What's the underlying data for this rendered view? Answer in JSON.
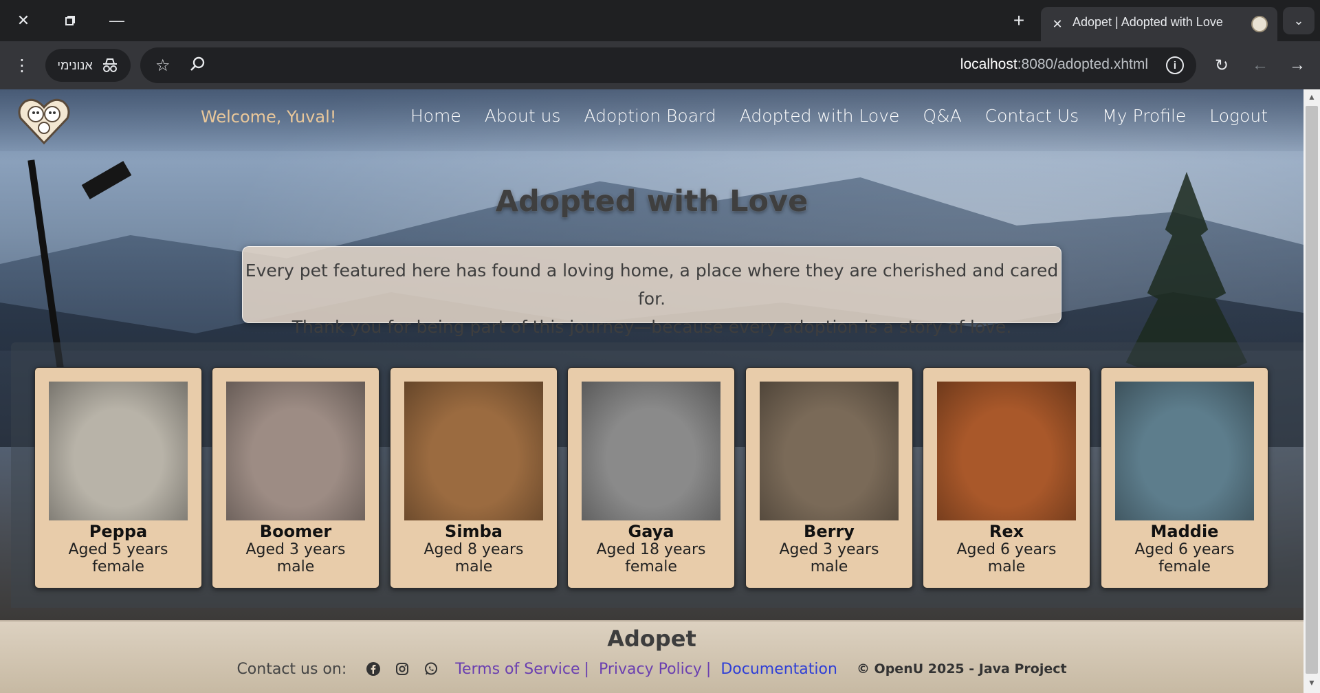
{
  "browser": {
    "tab_title": "Adopet | Adopted with Love",
    "incognito_label": "אנונימי",
    "url_host": "localhost",
    "url_path": ":8080/adopted.xhtml",
    "icons": {
      "close": "close-icon",
      "restore": "restore-icon",
      "minimize": "minimize-icon",
      "new_tab": "plus-icon",
      "menu": "kebab-menu-icon",
      "incognito": "incognito-icon",
      "star": "star-icon",
      "zoom": "zoom-icon",
      "info": "info-icon",
      "reload": "reload-icon",
      "back": "arrow-left-icon",
      "forward": "arrow-right-icon"
    }
  },
  "header": {
    "welcome": "Welcome, Yuval!",
    "nav": [
      "Home",
      "About us",
      "Adoption Board",
      "Adopted with Love",
      "Q&A",
      "Contact Us",
      "My Profile",
      "Logout"
    ]
  },
  "main": {
    "title": "Adopted with Love",
    "intro_line1": "Every pet featured here has found a loving home, a place where they are cherished and cared for.",
    "intro_line2": "Thank you for being part of this journey—because every adoption is a story of love."
  },
  "pets": [
    {
      "name": "Peppa",
      "age": "Aged 5 years",
      "gender": "female",
      "photo_color": "#b8b3a8"
    },
    {
      "name": "Boomer",
      "age": "Aged 3 years",
      "gender": "male",
      "photo_color": "#9d8c84"
    },
    {
      "name": "Simba",
      "age": "Aged 8 years",
      "gender": "male",
      "photo_color": "#9b6b40"
    },
    {
      "name": "Gaya",
      "age": "Aged 18 years",
      "gender": "female",
      "photo_color": "#8a8a8a"
    },
    {
      "name": "Berry",
      "age": "Aged 3 years",
      "gender": "male",
      "photo_color": "#7a6a58"
    },
    {
      "name": "Rex",
      "age": "Aged 6 years",
      "gender": "male",
      "photo_color": "#a9582a"
    },
    {
      "name": "Maddie",
      "age": "Aged 6 years",
      "gender": "female",
      "photo_color": "#5d7d8c"
    }
  ],
  "footer": {
    "brand": "Adopet",
    "contact": "Contact us on:",
    "terms": "Terms of Service",
    "privacy": "Privacy Policy",
    "docs": "Documentation",
    "sep": "|",
    "copyright": "© OpenU 2025 - Java Project"
  },
  "colors": {
    "card_bg": "#e8ccaa",
    "welcome": "#e9c79a",
    "link": "#6a3fb0"
  }
}
